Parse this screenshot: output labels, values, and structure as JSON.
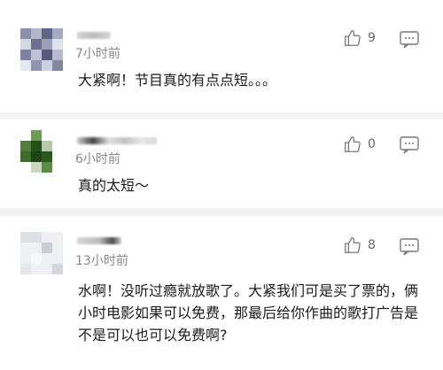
{
  "comments": [
    {
      "time": "7小时前",
      "text": "大紧啊！节目真的有点点短。。。",
      "likes": "9"
    },
    {
      "time": "6小时前",
      "text": "真的太短～",
      "likes": "0"
    },
    {
      "time": "13小时前",
      "text": "水啊！没听过瘾就放歌了。大紧我们可是买了票的，俩小时电影如果可以免费，那最后给你作曲的歌打广告是不是可以也可以免费啊?",
      "likes": "8"
    }
  ],
  "icons": {
    "like": "thumbs-up-icon",
    "reply": "comment-icon"
  },
  "colors": {
    "background": "#f3f3f3",
    "card": "#ffffff",
    "meta": "#888888"
  }
}
